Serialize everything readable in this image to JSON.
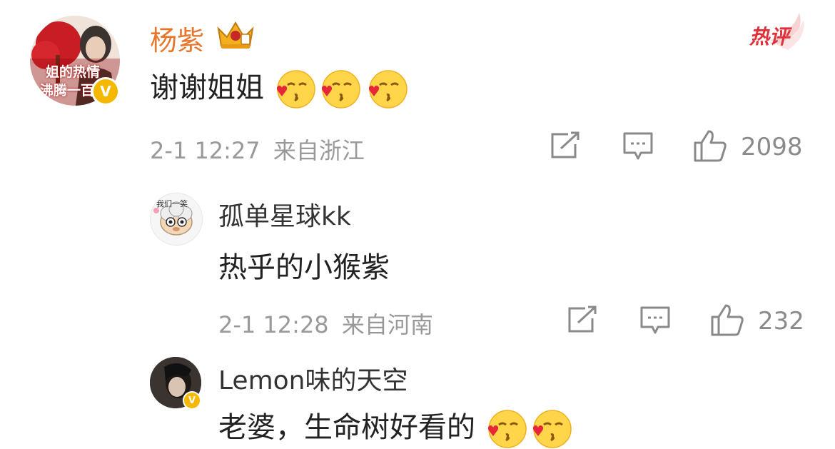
{
  "comments": [
    {
      "author": "杨紫",
      "text": "谢谢姐姐",
      "emoji": [
        "kiss-emoji",
        "kiss-emoji",
        "kiss-emoji"
      ],
      "time": "2-1 12:27",
      "location": "来自浙江",
      "likes": "2098",
      "hot_badge": "热评",
      "avatar_text": [
        "姐的热情",
        "沸腾一百"
      ]
    },
    {
      "author": "孤单星球kk",
      "text": "热乎的小猴紫",
      "time": "2-1 12:28",
      "location": "来自河南",
      "likes": "232",
      "avatar_text": "我们一笑"
    },
    {
      "author": "Lemon味的天空",
      "text": "老婆，生命树好看的",
      "emoji": [
        "kiss-emoji",
        "kiss-emoji"
      ]
    }
  ],
  "colors": {
    "vip_name": "#e8772e",
    "text": "#222222",
    "meta": "#999999",
    "hot": "#e0303a",
    "verified": "#f5b800"
  }
}
